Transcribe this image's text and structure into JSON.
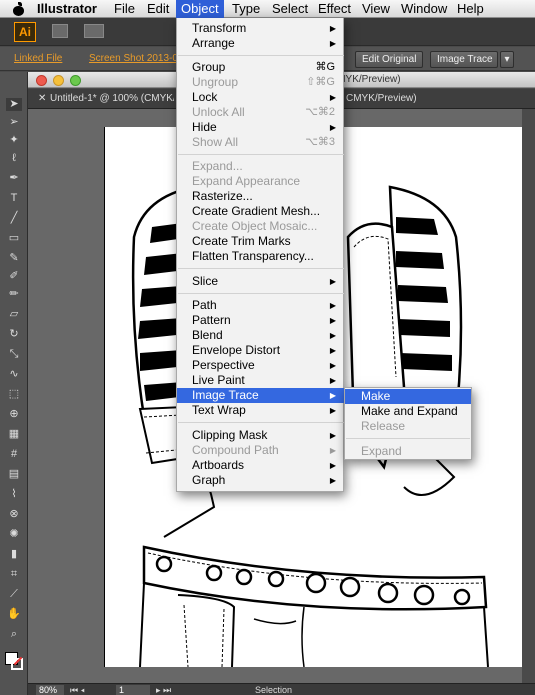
{
  "menubar": {
    "app": "Illustrator",
    "items": [
      "File",
      "Edit",
      "Object",
      "Type",
      "Select",
      "Effect",
      "View",
      "Window",
      "Help"
    ],
    "active": "Object"
  },
  "appbar": {
    "logo": "Ai"
  },
  "controlbar": {
    "linked_file": "Linked File",
    "file_name": "Screen Shot 2013-05-...",
    "edit_original": "Edit Original",
    "image_trace": "Image Trace"
  },
  "document": {
    "tab_title": "Untitled-1* @ 100% (CMYK/Preview)",
    "window_title_suffix": "CMYK/Preview)",
    "tab_suffix": "CMYK/Preview)",
    "zoom": "80%",
    "page": "1",
    "status": "Selection"
  },
  "object_menu": {
    "items": [
      {
        "label": "Transform",
        "submenu": true
      },
      {
        "label": "Arrange",
        "submenu": true
      },
      {
        "label": "Group",
        "shortcut": "⌘G"
      },
      {
        "label": "Ungroup",
        "shortcut": "⇧⌘G",
        "disabled": true
      },
      {
        "label": "Lock",
        "submenu": true
      },
      {
        "label": "Unlock All",
        "shortcut": "⌥⌘2",
        "disabled": true
      },
      {
        "label": "Hide",
        "submenu": true
      },
      {
        "label": "Show All",
        "shortcut": "⌥⌘3",
        "disabled": true
      },
      {
        "label": "Expand...",
        "disabled": true
      },
      {
        "label": "Expand Appearance",
        "disabled": true
      },
      {
        "label": "Rasterize..."
      },
      {
        "label": "Create Gradient Mesh..."
      },
      {
        "label": "Create Object Mosaic...",
        "disabled": true
      },
      {
        "label": "Create Trim Marks"
      },
      {
        "label": "Flatten Transparency..."
      },
      {
        "label": "Slice",
        "submenu": true
      },
      {
        "label": "Path",
        "submenu": true
      },
      {
        "label": "Pattern",
        "submenu": true
      },
      {
        "label": "Blend",
        "submenu": true
      },
      {
        "label": "Envelope Distort",
        "submenu": true
      },
      {
        "label": "Perspective",
        "submenu": true
      },
      {
        "label": "Live Paint",
        "submenu": true
      },
      {
        "label": "Image Trace",
        "submenu": true,
        "highlighted": true
      },
      {
        "label": "Text Wrap",
        "submenu": true
      },
      {
        "label": "Clipping Mask",
        "submenu": true
      },
      {
        "label": "Compound Path",
        "submenu": true,
        "disabled": true
      },
      {
        "label": "Artboards",
        "submenu": true
      },
      {
        "label": "Graph",
        "submenu": true
      }
    ]
  },
  "image_trace_submenu": {
    "items": [
      {
        "label": "Make",
        "highlighted": true
      },
      {
        "label": "Make and Expand"
      },
      {
        "label": "Release",
        "disabled": true
      },
      {
        "label": "Expand",
        "disabled": true
      }
    ]
  },
  "colors": {
    "menu_highlight": "#3468e0",
    "ai_orange": "#ff9a00",
    "ui_dark": "#535353"
  }
}
